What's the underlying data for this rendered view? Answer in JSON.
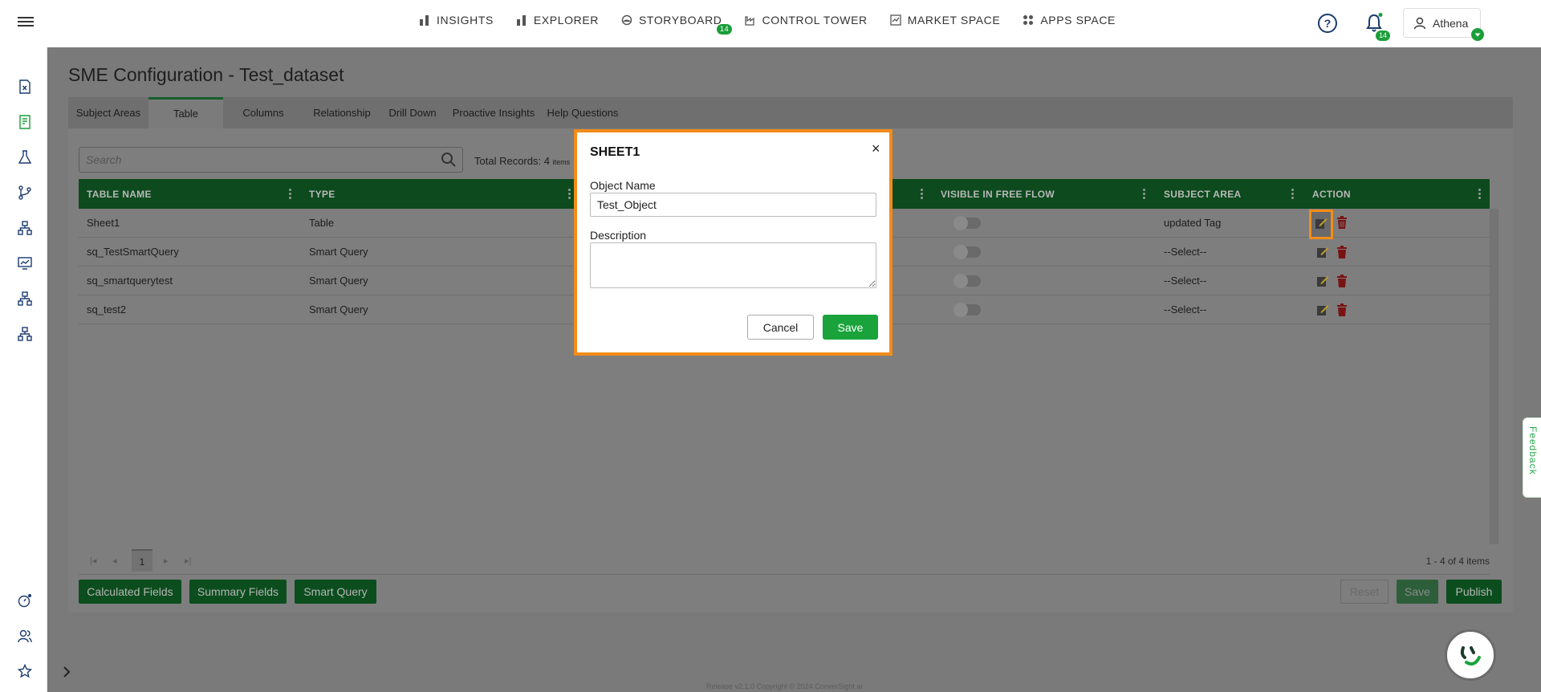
{
  "topnav": {
    "menu_icon": "hamburger-icon",
    "links": [
      {
        "label": "INSIGHTS",
        "icon": "bar-chart-icon"
      },
      {
        "label": "EXPLORER",
        "icon": "bar-chart-icon"
      },
      {
        "label": "STORYBOARD",
        "icon": "storyboard-icon",
        "badge": "14"
      },
      {
        "label": "CONTROL TOWER",
        "icon": "factory-icon"
      },
      {
        "label": "MARKET SPACE",
        "icon": "market-icon"
      },
      {
        "label": "APPS SPACE",
        "icon": "apps-grid-icon"
      }
    ],
    "help_label": "?",
    "notification_badge": "14",
    "user_name": "Athena",
    "accent_color": "#1a9e3a"
  },
  "page": {
    "title": "SME Configuration - Test_dataset",
    "tabs": [
      "Subject Areas",
      "Table",
      "Columns",
      "Relationship",
      "Drill Down",
      "Proactive Insights",
      "Help Questions"
    ],
    "active_tab": "Table"
  },
  "search": {
    "placeholder": "Search"
  },
  "total": {
    "label": "Total Records: 4",
    "unit": "items"
  },
  "table": {
    "headers": [
      "TABLE NAME",
      "TYPE",
      "VISIBLE IN FREE FLOW",
      "SUBJECT AREA",
      "ACTION"
    ],
    "rows": [
      {
        "name": "Sheet1",
        "type": "Table",
        "subject": "updated Tag"
      },
      {
        "name": "sq_TestSmartQuery",
        "type": "Smart Query",
        "subject": "--Select--"
      },
      {
        "name": "sq_smartquerytest",
        "type": "Smart Query",
        "subject": "--Select--"
      },
      {
        "name": "sq_test2",
        "type": "Smart Query",
        "subject": "--Select--"
      }
    ]
  },
  "pager": {
    "page": "1",
    "info": "1 - 4 of 4 items"
  },
  "buttons": {
    "calculated": "Calculated Fields",
    "summary": "Summary Fields",
    "smart_query": "Smart Query",
    "reset": "Reset",
    "save": "Save",
    "publish": "Publish"
  },
  "footer": "Release v2.1.0 Copyright © 2024 ConverSight.ai",
  "feedback": "Feedback",
  "modal": {
    "title": "SHEET1",
    "close": "×",
    "object_name_label": "Object Name",
    "object_name_value": "Test_Object",
    "description_label": "Description",
    "cancel": "Cancel",
    "save": "Save",
    "highlight_color": "#f28c1a"
  }
}
